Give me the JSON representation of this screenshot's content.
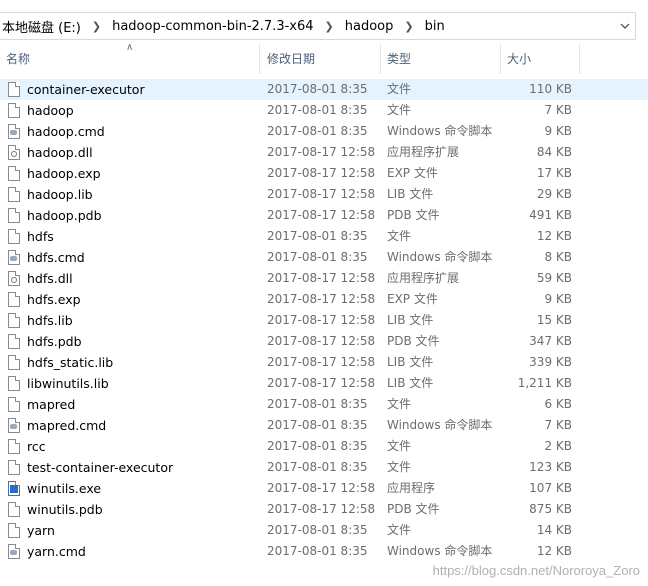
{
  "breadcrumbs": [
    "本地磁盘 (E:)",
    "hadoop-common-bin-2.7.3-x64",
    "hadoop",
    "bin"
  ],
  "columns": {
    "name": "名称",
    "date": "修改日期",
    "type": "类型",
    "size": "大小"
  },
  "files": [
    {
      "name": "container-executor",
      "date": "2017-08-01 8:35",
      "type": "文件",
      "size": "110 KB",
      "icon": "file-icon",
      "selected": true
    },
    {
      "name": "hadoop",
      "date": "2017-08-01 8:35",
      "type": "文件",
      "size": "7 KB",
      "icon": "file-icon"
    },
    {
      "name": "hadoop.cmd",
      "date": "2017-08-01 8:35",
      "type": "Windows 命令脚本",
      "size": "9 KB",
      "icon": "cmd-script-icon"
    },
    {
      "name": "hadoop.dll",
      "date": "2017-08-17 12:58",
      "type": "应用程序扩展",
      "size": "84 KB",
      "icon": "dll-icon"
    },
    {
      "name": "hadoop.exp",
      "date": "2017-08-17 12:58",
      "type": "EXP 文件",
      "size": "17 KB",
      "icon": "file-icon"
    },
    {
      "name": "hadoop.lib",
      "date": "2017-08-17 12:58",
      "type": "LIB 文件",
      "size": "29 KB",
      "icon": "file-icon"
    },
    {
      "name": "hadoop.pdb",
      "date": "2017-08-17 12:58",
      "type": "PDB 文件",
      "size": "491 KB",
      "icon": "file-icon"
    },
    {
      "name": "hdfs",
      "date": "2017-08-01 8:35",
      "type": "文件",
      "size": "12 KB",
      "icon": "file-icon"
    },
    {
      "name": "hdfs.cmd",
      "date": "2017-08-01 8:35",
      "type": "Windows 命令脚本",
      "size": "8 KB",
      "icon": "cmd-script-icon"
    },
    {
      "name": "hdfs.dll",
      "date": "2017-08-17 12:58",
      "type": "应用程序扩展",
      "size": "59 KB",
      "icon": "dll-icon"
    },
    {
      "name": "hdfs.exp",
      "date": "2017-08-17 12:58",
      "type": "EXP 文件",
      "size": "9 KB",
      "icon": "file-icon"
    },
    {
      "name": "hdfs.lib",
      "date": "2017-08-17 12:58",
      "type": "LIB 文件",
      "size": "15 KB",
      "icon": "file-icon"
    },
    {
      "name": "hdfs.pdb",
      "date": "2017-08-17 12:58",
      "type": "PDB 文件",
      "size": "347 KB",
      "icon": "file-icon"
    },
    {
      "name": "hdfs_static.lib",
      "date": "2017-08-17 12:58",
      "type": "LIB 文件",
      "size": "339 KB",
      "icon": "file-icon"
    },
    {
      "name": "libwinutils.lib",
      "date": "2017-08-17 12:58",
      "type": "LIB 文件",
      "size": "1,211 KB",
      "icon": "file-icon"
    },
    {
      "name": "mapred",
      "date": "2017-08-01 8:35",
      "type": "文件",
      "size": "6 KB",
      "icon": "file-icon"
    },
    {
      "name": "mapred.cmd",
      "date": "2017-08-01 8:35",
      "type": "Windows 命令脚本",
      "size": "7 KB",
      "icon": "cmd-script-icon"
    },
    {
      "name": "rcc",
      "date": "2017-08-01 8:35",
      "type": "文件",
      "size": "2 KB",
      "icon": "file-icon"
    },
    {
      "name": "test-container-executor",
      "date": "2017-08-01 8:35",
      "type": "文件",
      "size": "123 KB",
      "icon": "file-icon"
    },
    {
      "name": "winutils.exe",
      "date": "2017-08-17 12:58",
      "type": "应用程序",
      "size": "107 KB",
      "icon": "exe-icon"
    },
    {
      "name": "winutils.pdb",
      "date": "2017-08-17 12:58",
      "type": "PDB 文件",
      "size": "875 KB",
      "icon": "file-icon"
    },
    {
      "name": "yarn",
      "date": "2017-08-01 8:35",
      "type": "文件",
      "size": "14 KB",
      "icon": "file-icon"
    },
    {
      "name": "yarn.cmd",
      "date": "2017-08-01 8:35",
      "type": "Windows 命令脚本",
      "size": "12 KB",
      "icon": "cmd-script-icon"
    }
  ],
  "watermark": "https://blog.csdn.net/Nororoya_Zoro",
  "colors": {
    "selection": "#e5f3ff",
    "header_text": "#4c607a",
    "meta_text": "#6d6d6d"
  }
}
